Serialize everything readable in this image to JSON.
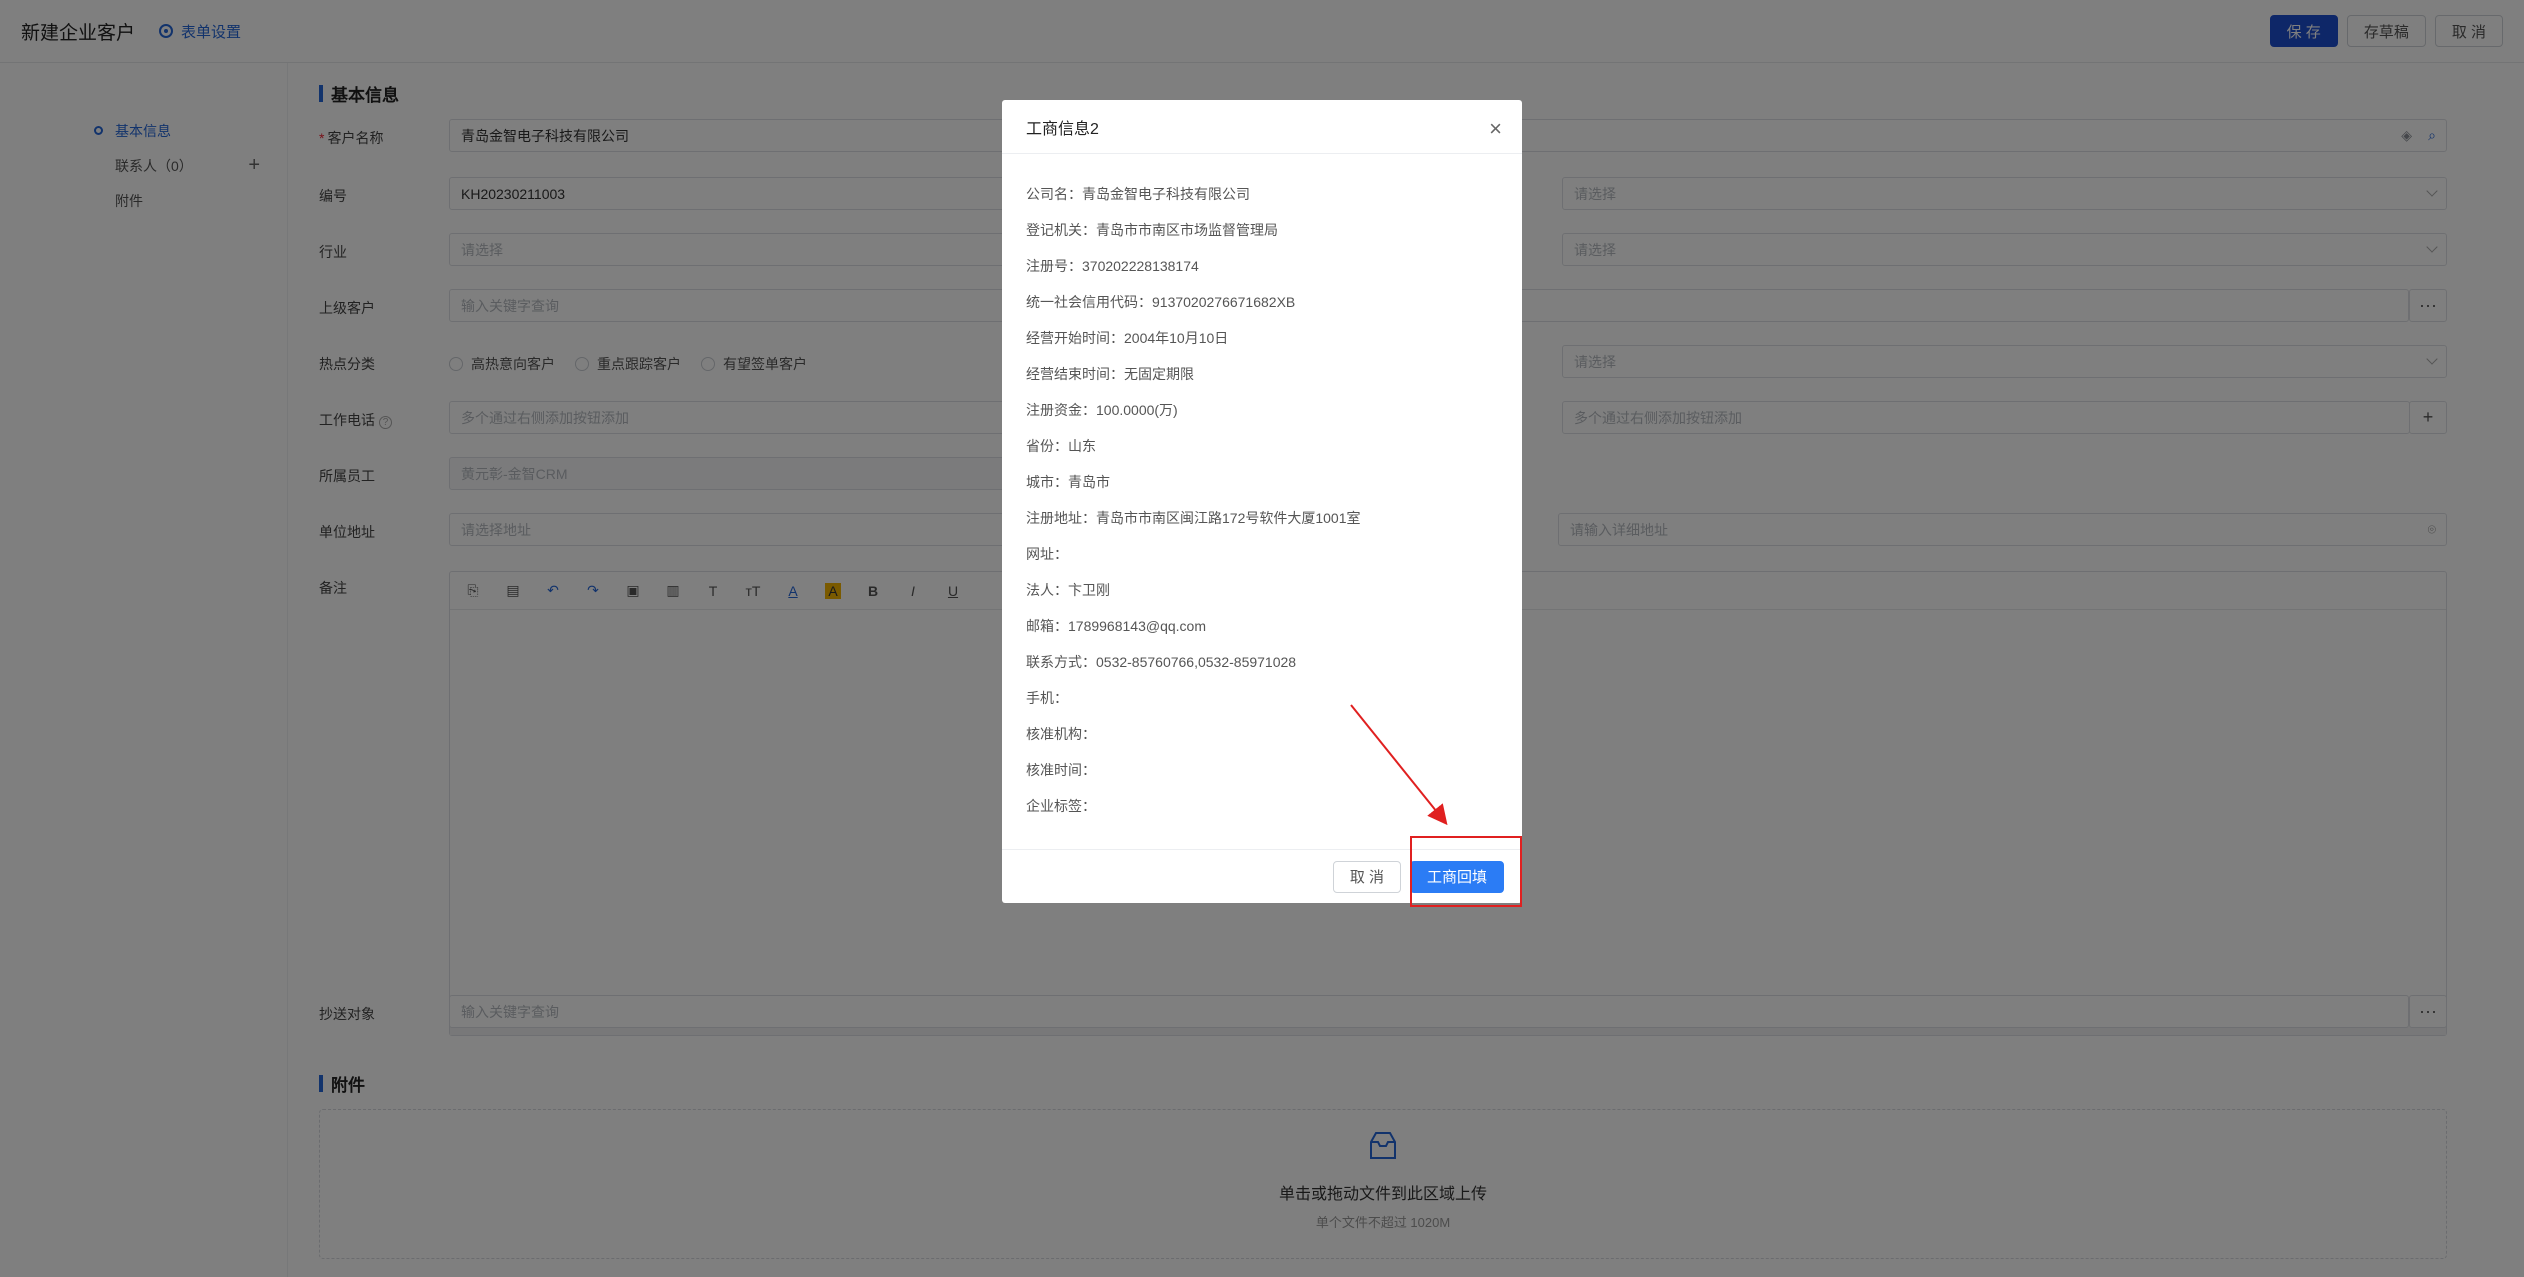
{
  "header": {
    "title": "新建企业客户",
    "form_settings": "表单设置",
    "save": "保 存",
    "draft": "存草稿",
    "cancel": "取 消"
  },
  "sidebar": {
    "items": [
      {
        "label": "基本信息"
      },
      {
        "label": "联系人（0）"
      },
      {
        "label": "附件"
      }
    ],
    "add": "+"
  },
  "sections": {
    "basic": "基本信息",
    "attachments": "附件"
  },
  "form": {
    "customer_name": {
      "label": "客户名称",
      "value": "青岛金智电子科技有限公司"
    },
    "code": {
      "label": "编号",
      "value": "KH20230211003",
      "right_placeholder": "请选择"
    },
    "industry": {
      "label": "行业",
      "placeholder": "请选择",
      "right_placeholder": "请选择"
    },
    "parent": {
      "label": "上级客户",
      "placeholder": "输入关键字查询",
      "more": "···"
    },
    "hot": {
      "label": "热点分类",
      "options": [
        "高热意向客户",
        "重点跟踪客户",
        "有望签单客户"
      ],
      "right_placeholder": "请选择"
    },
    "phone": {
      "label": "工作电话",
      "placeholder": "多个通过右侧添加按钮添加",
      "right_placeholder": "多个通过右侧添加按钮添加",
      "add": "+"
    },
    "owner": {
      "label": "所属员工",
      "value": "黄元彰-金智CRM"
    },
    "address": {
      "label": "单位地址",
      "placeholder": "请选择地址",
      "right_placeholder": "请输入详细地址"
    },
    "remark": {
      "label": "备注",
      "toolbar": [
        "⎘",
        "▤",
        "↶",
        "↷",
        "▣",
        "▥",
        "T",
        "тT",
        "A",
        "A",
        "B",
        "I",
        "U"
      ]
    },
    "cc": {
      "label": "抄送对象",
      "placeholder": "输入关键字查询",
      "more": "···"
    }
  },
  "upload": {
    "title": "单击或拖动文件到此区域上传",
    "hint": "单个文件不超过 1020M"
  },
  "modal": {
    "title": "工商信息2",
    "close": "×",
    "lines": [
      "公司名：青岛金智电子科技有限公司",
      "登记机关：青岛市市南区市场监督管理局",
      "注册号：370202228138174",
      "统一社会信用代码：913702027667​1682XB",
      "经营开始时间：2004年10月10日",
      "经营结束时间：无固定期限",
      "注册资金：100.0000(万)",
      "省份：山东",
      "城市：青岛市",
      "注册地址：青岛市市南区闽江路172号软件大厦1001室",
      "网址：",
      "法人：卞卫刚",
      "邮箱：1789968143@qq.com",
      "联系方式：0532-85760766,0532-85971028",
      "手机：",
      "核准机构：",
      "核准时间：",
      "企业标签："
    ],
    "cancel": "取 消",
    "confirm": "工商回填"
  },
  "colors": {
    "primary": "#1d4fd1",
    "modal_confirm": "#2b7cf5",
    "highlight": "#e02020"
  }
}
